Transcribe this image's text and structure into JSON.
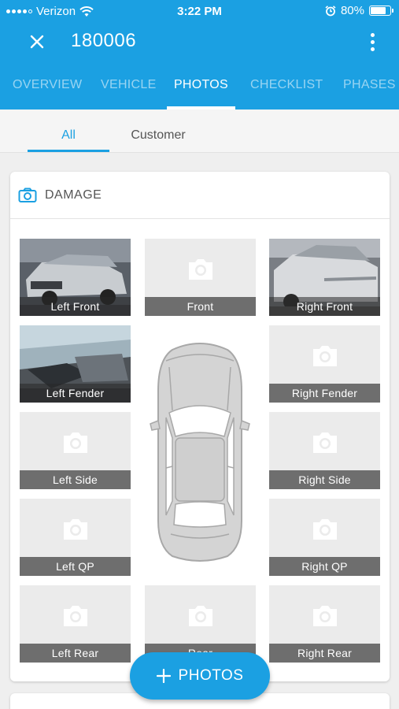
{
  "status_bar": {
    "carrier": "Verizon",
    "time": "3:22 PM",
    "battery": "80%",
    "battery_level": 0.8,
    "icons": [
      "signal-icon",
      "wifi-icon",
      "alarm-icon",
      "battery-icon"
    ]
  },
  "header": {
    "title": "180006",
    "close_icon": "close-icon",
    "menu_icon": "more-vertical-icon"
  },
  "tabs": [
    "OVERVIEW",
    "VEHICLE",
    "PHOTOS",
    "CHECKLIST",
    "PHASES"
  ],
  "active_tab": "PHOTOS",
  "subtabs": [
    "All",
    "Customer"
  ],
  "active_subtab": "All",
  "damage_card": {
    "title": "DAMAGE",
    "icon": "camera-icon",
    "tiles": [
      {
        "label": "Left Front",
        "has_photo": true
      },
      {
        "label": "Front",
        "has_photo": false
      },
      {
        "label": "Right Front",
        "has_photo": true
      },
      {
        "label": "Left Fender",
        "has_photo": true
      },
      {
        "label": "Right Fender",
        "has_photo": false
      },
      {
        "label": "Left Side",
        "has_photo": false
      },
      {
        "label": "Right Side",
        "has_photo": false
      },
      {
        "label": "Left QP",
        "has_photo": false
      },
      {
        "label": "Right QP",
        "has_photo": false
      },
      {
        "label": "Left Rear",
        "has_photo": false
      },
      {
        "label": "Rear",
        "has_photo": false
      },
      {
        "label": "Right Rear",
        "has_photo": false
      }
    ]
  },
  "fab": {
    "label": "PHOTOS",
    "icon": "plus-icon"
  },
  "colors": {
    "primary": "#1ba0e2",
    "label_bg": "#6e6e6e",
    "tile_bg": "#ebebeb"
  }
}
